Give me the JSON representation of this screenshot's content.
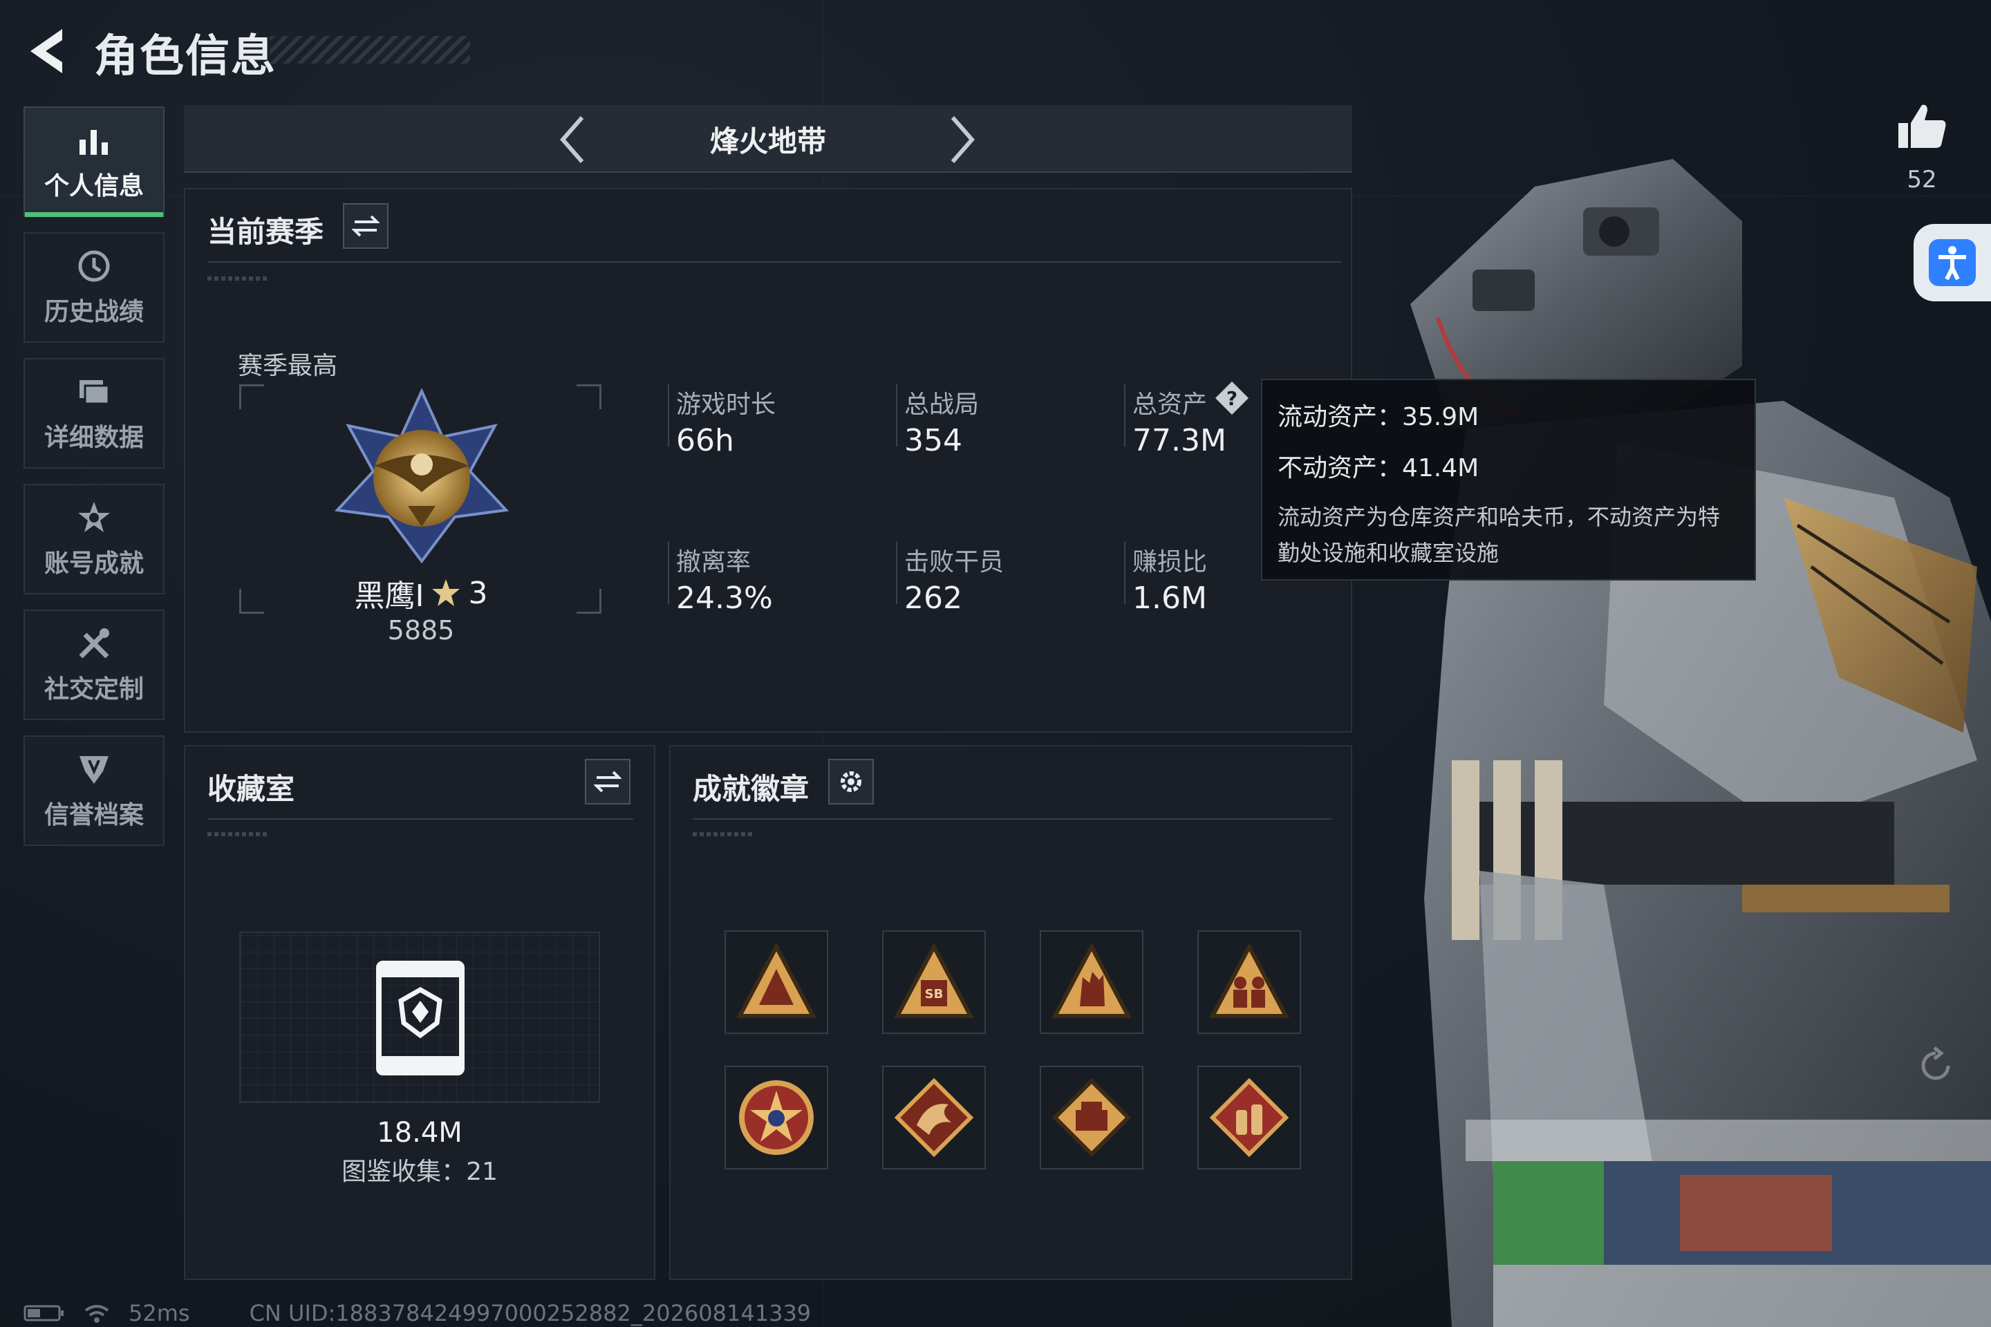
{
  "header": {
    "title": "角色信息"
  },
  "sidebar": {
    "items": [
      {
        "label": "个人信息",
        "icon": "bar-chart-icon",
        "active": true
      },
      {
        "label": "历史战绩",
        "icon": "history-clock-icon",
        "active": false
      },
      {
        "label": "详细数据",
        "icon": "folder-icon",
        "active": false
      },
      {
        "label": "账号成就",
        "icon": "achievement-star-icon",
        "active": false
      },
      {
        "label": "社交定制",
        "icon": "tools-icon",
        "active": false
      },
      {
        "label": "信誉档案",
        "icon": "shield-emblem-icon",
        "active": false
      }
    ]
  },
  "mode_selector": {
    "title": "烽火地带"
  },
  "season_panel": {
    "title": "当前赛季",
    "rank_label": "赛季最高",
    "rank_name": "黑鹰I",
    "rank_stars": "3",
    "rank_score": "5885",
    "stats": [
      {
        "label": "游戏时长",
        "value": "66h"
      },
      {
        "label": "总战局",
        "value": "354"
      },
      {
        "label": "总资产",
        "value": "77.3M"
      },
      {
        "label": "撤离率",
        "value": "24.3%"
      },
      {
        "label": "击败干员",
        "value": "262"
      },
      {
        "label": "赚损比",
        "value": "1.6M"
      }
    ]
  },
  "collection_panel": {
    "title": "收藏室",
    "value": "18.4M",
    "catalog": "图鉴收集：21"
  },
  "badges_panel": {
    "title": "成就徽章",
    "badges": [
      "triangle-hands-badge",
      "triangle-sb-badge",
      "triangle-fist-badge",
      "triangle-soldiers-badge",
      "star-emblem-badge",
      "diamond-dragon-badge",
      "diamond-printer-badge",
      "diamond-bottles-badge"
    ]
  },
  "tooltip": {
    "liquid": "流动资产：35.9M",
    "fixed": "不动资产：41.4M",
    "description": "流动资产为仓库资产和哈夫币，不动资产为特勤处设施和收藏室设施"
  },
  "likes": {
    "count": "52"
  },
  "status_bar": {
    "ping": "52ms",
    "uid": "CN UID:188378424997000252882_202608141339"
  },
  "colors": {
    "accent_green": "#4fc07a",
    "accessibility_blue": "#2f80ff"
  }
}
